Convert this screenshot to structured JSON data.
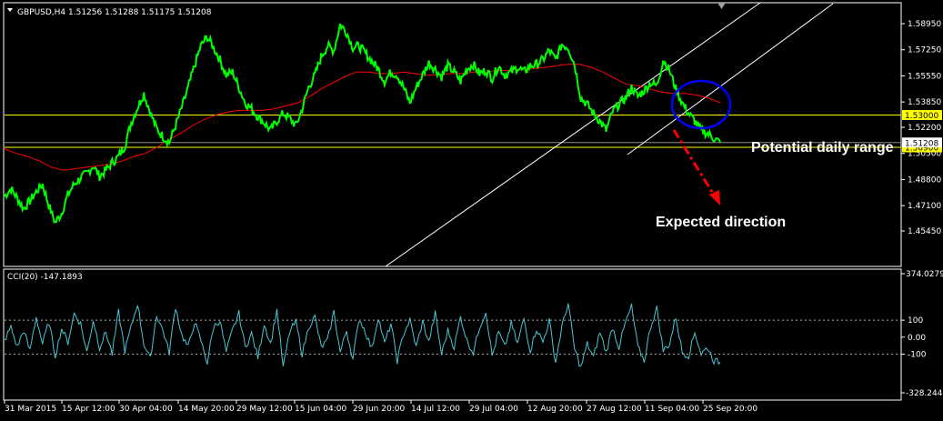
{
  "header": {
    "symbol_text": "GBPUSD,H4  1.51256 1.51288 1.51175 1.51208"
  },
  "indicator": {
    "label": "CCI(20) -147.1893",
    "axis_ticks": [
      "374.0279",
      "100",
      "0.00",
      "-100",
      "-328.2446"
    ],
    "axis_values": [
      374.0279,
      100,
      0,
      -100,
      -328.2446
    ],
    "dotted_levels": [
      100,
      -100
    ],
    "line_color": "#49c7d3"
  },
  "annotations": {
    "potential_range": "Potential daily range",
    "expected_direction": "Expected direction"
  },
  "colors": {
    "background": "#000000",
    "grid_frame": "#ffffff",
    "price_line": "#00ff00",
    "moving_average": "#ff0000",
    "support_resistance": "#ffff00",
    "trend_channel": "#ffffff",
    "circle": "#0000ff",
    "arrow": "#ff0000"
  },
  "chart_data": {
    "type": "line",
    "title": "GBPUSD,H4",
    "ohlc_header": {
      "open": 1.51256,
      "high": 1.51288,
      "low": 1.51175,
      "close": 1.51208
    },
    "x_tick_labels": [
      "31 Mar 2015",
      "15 Apr 12:00",
      "30 Apr 04:00",
      "14 May 20:00",
      "29 May 12:00",
      "15 Jun 04:00",
      "29 Jun 20:00",
      "14 Jul 12:00",
      "29 Jul 04:00",
      "12 Aug 20:00",
      "27 Aug 12:00",
      "11 Sep 04:00",
      "25 Sep 20:00"
    ],
    "y_tick_labels": [
      "1.58950",
      "1.57250",
      "1.55550",
      "1.53850",
      "1.52200",
      "1.50500",
      "1.48800",
      "1.47100",
      "1.45450"
    ],
    "y_tick_values": [
      1.5895,
      1.5725,
      1.5555,
      1.5385,
      1.522,
      1.505,
      1.488,
      1.471,
      1.4545
    ],
    "ylim": [
      1.452,
      1.597
    ],
    "highlighted_levels": [
      {
        "label": "1.53000",
        "value": 1.53
      },
      {
        "label": "1.50900",
        "value": 1.509
      }
    ],
    "current_price_label": "1.51208",
    "current_price": 1.51208,
    "series": [
      {
        "role": "price",
        "values": [
          1.477,
          1.482,
          1.476,
          1.469,
          1.474,
          1.48,
          1.485,
          1.471,
          1.46,
          1.466,
          1.478,
          1.485,
          1.489,
          1.492,
          1.497,
          1.49,
          1.494,
          1.499,
          1.503,
          1.51,
          1.525,
          1.535,
          1.544,
          1.532,
          1.521,
          1.516,
          1.512,
          1.523,
          1.535,
          1.548,
          1.562,
          1.575,
          1.581,
          1.574,
          1.566,
          1.556,
          1.558,
          1.548,
          1.538,
          1.534,
          1.529,
          1.525,
          1.52,
          1.526,
          1.531,
          1.528,
          1.523,
          1.534,
          1.548,
          1.556,
          1.568,
          1.575,
          1.572,
          1.589,
          1.584,
          1.574,
          1.575,
          1.57,
          1.565,
          1.56,
          1.552,
          1.558,
          1.556,
          1.548,
          1.538,
          1.548,
          1.556,
          1.564,
          1.56,
          1.555,
          1.562,
          1.558,
          1.552,
          1.56,
          1.563,
          1.557,
          1.559,
          1.554,
          1.562,
          1.556,
          1.558,
          1.561,
          1.558,
          1.562,
          1.563,
          1.566,
          1.572,
          1.566,
          1.576,
          1.574,
          1.563,
          1.541,
          1.537,
          1.531,
          1.526,
          1.52,
          1.532,
          1.537,
          1.541,
          1.548,
          1.542,
          1.546,
          1.551,
          1.549,
          1.566,
          1.559,
          1.547,
          1.538,
          1.531,
          1.526,
          1.52,
          1.518,
          1.515,
          1.512
        ]
      },
      {
        "role": "moving_average",
        "values": [
          1.508,
          1.505,
          1.503,
          1.5,
          1.496,
          1.494,
          1.495,
          1.496,
          1.497,
          1.498,
          1.5,
          1.503,
          1.505,
          1.509,
          1.514,
          1.518,
          1.523,
          1.527,
          1.53,
          1.532,
          1.533,
          1.533,
          1.533,
          1.534,
          1.536,
          1.538,
          1.542,
          1.547,
          1.551,
          1.555,
          1.558,
          1.558,
          1.557,
          1.557,
          1.558,
          1.557,
          1.556,
          1.556,
          1.557,
          1.557,
          1.558,
          1.558,
          1.559,
          1.559,
          1.56,
          1.56,
          1.561,
          1.562,
          1.563,
          1.563,
          1.561,
          1.558,
          1.554,
          1.55,
          1.549,
          1.547,
          1.545,
          1.544,
          1.544,
          1.543,
          1.541,
          1.538
        ]
      },
      {
        "role": "cci",
        "values": [
          -20,
          60,
          -60,
          40,
          -80,
          120,
          -40,
          90,
          -110,
          50,
          -30,
          140,
          80,
          -90,
          100,
          -60,
          30,
          -100,
          150,
          -80,
          60,
          200,
          -40,
          -130,
          130,
          40,
          -90,
          180,
          10,
          -60,
          90,
          -20,
          -150,
          60,
          100,
          -90,
          40,
          140,
          -60,
          20,
          -120,
          80,
          -40,
          160,
          -180,
          30,
          90,
          -100,
          60,
          120,
          -60,
          -20,
          150,
          -90,
          40,
          -130,
          110,
          30,
          -70,
          120,
          -40,
          80,
          -140,
          20,
          100,
          -60,
          90,
          -30,
          140,
          -100,
          40,
          -60,
          120,
          -20,
          -90,
          60,
          150,
          -110,
          30,
          -60,
          80,
          -40,
          110,
          -80,
          50,
          -30,
          100,
          -150,
          60,
          200,
          -70,
          -180,
          -40,
          -120,
          30,
          -90,
          60,
          -60,
          80,
          180,
          -60,
          -140,
          60,
          170,
          -80,
          -40,
          120,
          -90,
          -110,
          30,
          -100,
          -60,
          -140,
          -147
        ]
      }
    ],
    "grid": false,
    "legend": "none"
  }
}
